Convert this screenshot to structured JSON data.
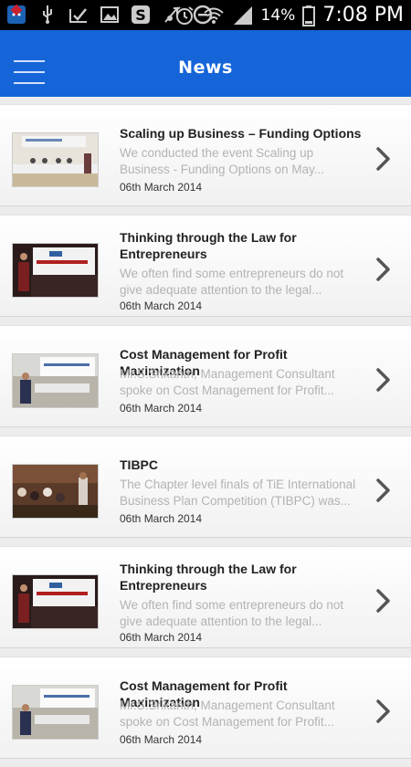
{
  "status_bar": {
    "battery": "14%",
    "time": "7:08 PM"
  },
  "app_bar": {
    "title": "News"
  },
  "news": [
    {
      "title": "Scaling up Business – Funding Options",
      "desc": "We conducted the event Scaling up Business - Funding Options on May...",
      "date": "06th March 2014",
      "thumb": "conference"
    },
    {
      "title": "Thinking through the Law for Entrepreneurs",
      "desc": "We often find some entrepreneurs do not give adequate attention to the legal...",
      "date": "06th March 2014",
      "thumb": "banner"
    },
    {
      "title": "Cost Management for Profit Maximization",
      "desc": "Mr.S.Srikanth, Management Consultant spoke on Cost Management for Profit...",
      "date": "06th March 2014",
      "thumb": "screen"
    },
    {
      "title": "TIBPC",
      "desc": "The Chapter level finals of TiE International Business Plan Competition (TIBPC) was...",
      "date": "06th March 2014",
      "thumb": "audience"
    },
    {
      "title": "Thinking through the Law for Entrepreneurs",
      "desc": "We often find some entrepreneurs do not give adequate attention to the legal...",
      "date": "06th March 2014",
      "thumb": "banner"
    },
    {
      "title": "Cost Management for Profit Maximization",
      "desc": "Mr.S.Srikanth, Management Consultant spoke on Cost Management for Profit...",
      "date": "06th March 2014",
      "thumb": "screen"
    }
  ],
  "colors": {
    "app_bar": "#1565d8",
    "status_bar": "#000000",
    "background": "#ececec"
  }
}
